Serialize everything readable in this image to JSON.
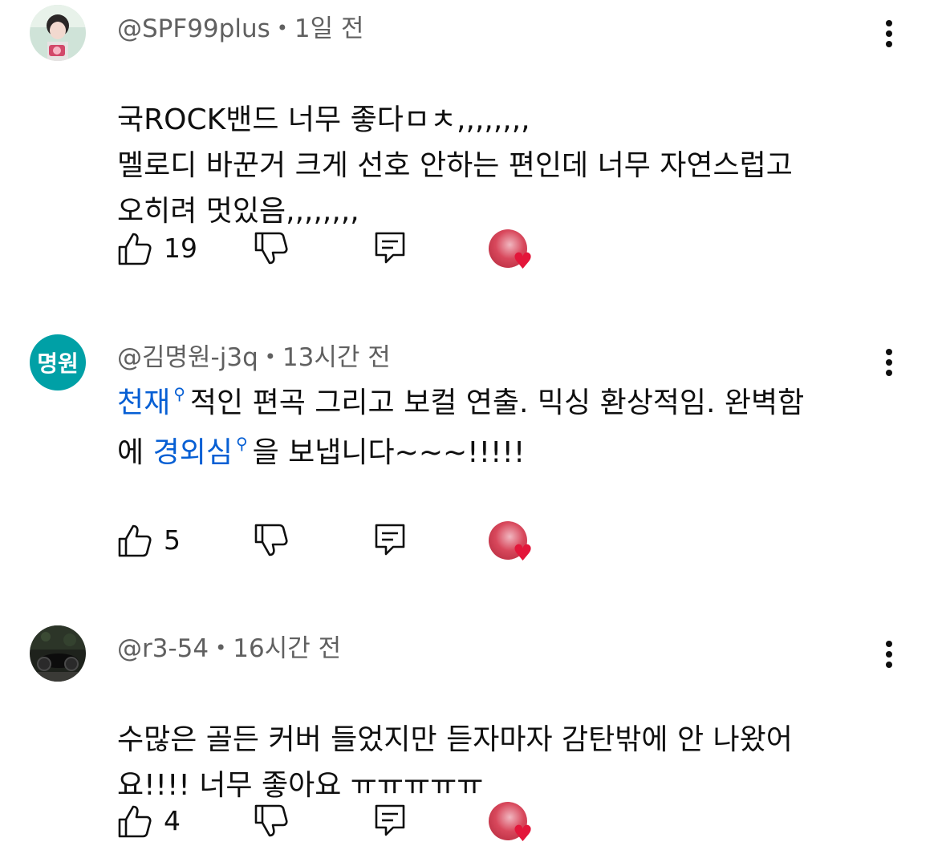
{
  "comments": [
    {
      "author": "@SPF99plus",
      "time": "1일 전",
      "body_parts": [
        {
          "text": "국ROCK밴드 너무 좋다ㅁㅊ,,,,,,,,\n멜로디 바꾼거 크게 선호 안하는 편인데 너무 자연스럽고\n오히려 멋있음,,,,,,,,"
        }
      ],
      "likes": "19",
      "avatar_type": "photo"
    },
    {
      "author": "@김명원-j3q",
      "time": "13시간 전",
      "avatar_text": "명원",
      "body_parts": [
        {
          "text": "천재",
          "tag": true
        },
        {
          "text": "적인 편곡 그리고 보컬 연출. 믹싱  환상적임. 완벽함\n에 "
        },
        {
          "text": "경외심",
          "tag": true
        },
        {
          "text": "을 보냅니다~~~!!!!!"
        }
      ],
      "likes": "5",
      "avatar_type": "text"
    },
    {
      "author": "@r3-54",
      "time": "16시간 전",
      "body_parts": [
        {
          "text": "수많은 골든 커버 들었지만 듣자마자 감탄밖에 안 나왔어\n요!!!! 너무 좋아요 ㅠㅠㅠㅠㅠ"
        }
      ],
      "likes": "4",
      "avatar_type": "photo-dark"
    }
  ],
  "separator": "•",
  "icons": {
    "like": "thumbs-up-icon",
    "dislike": "thumbs-down-icon",
    "reply": "reply-comment-icon",
    "more": "more-vert-icon",
    "search_tag": "search-tag-icon",
    "creator_heart": "heart-icon"
  },
  "colors": {
    "tag": "#065fd4",
    "heart": "#e3163a",
    "avatar_bg": "#00a0a6",
    "meta": "#606060"
  }
}
